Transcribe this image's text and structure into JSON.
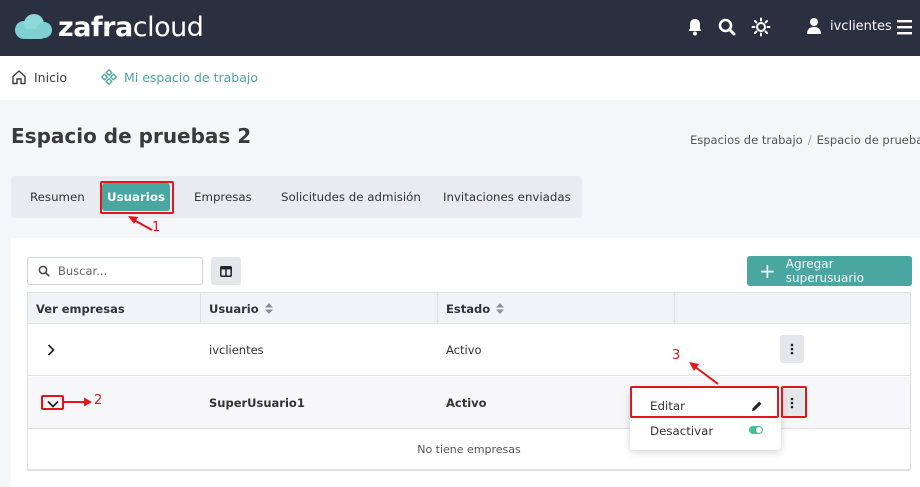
{
  "brand": {
    "name_bold": "zafra",
    "name_light": "cloud"
  },
  "header": {
    "username": "ivclientes"
  },
  "nav": {
    "home": "Inicio",
    "workspace": "Mi espacio de trabajo"
  },
  "page": {
    "title": "Espacio de pruebas 2",
    "breadcrumbs": [
      "Espacios de trabajo",
      "/",
      "Espacio de pruebas"
    ]
  },
  "tabs": [
    {
      "label": "Resumen"
    },
    {
      "label": "Usuarios",
      "active": true
    },
    {
      "label": "Empresas"
    },
    {
      "label": "Solicitudes de admisión"
    },
    {
      "label": "Invitaciones enviadas"
    }
  ],
  "toolbar": {
    "search_placeholder": "Buscar...",
    "add_label": "Agregar superusuario"
  },
  "table": {
    "headers": [
      "Ver empresas",
      "Usuario",
      "Estado",
      ""
    ],
    "rows": [
      {
        "user": "ivclientes",
        "status": "Activo"
      },
      {
        "user": "SuperUsuario1",
        "status": "Activo",
        "expanded": true
      }
    ],
    "empty_message": "No tiene empresas"
  },
  "menu": {
    "edit": "Editar",
    "deactivate": "Desactivar",
    "deactivate_toggle_on": true
  },
  "annotations": {
    "a1": "1",
    "a2": "2",
    "a3": "3"
  },
  "colors": {
    "navbar": "#2b3040",
    "accent": "#4aa6a0",
    "annotation": "#e3151a",
    "toggle": "#3cc497"
  }
}
